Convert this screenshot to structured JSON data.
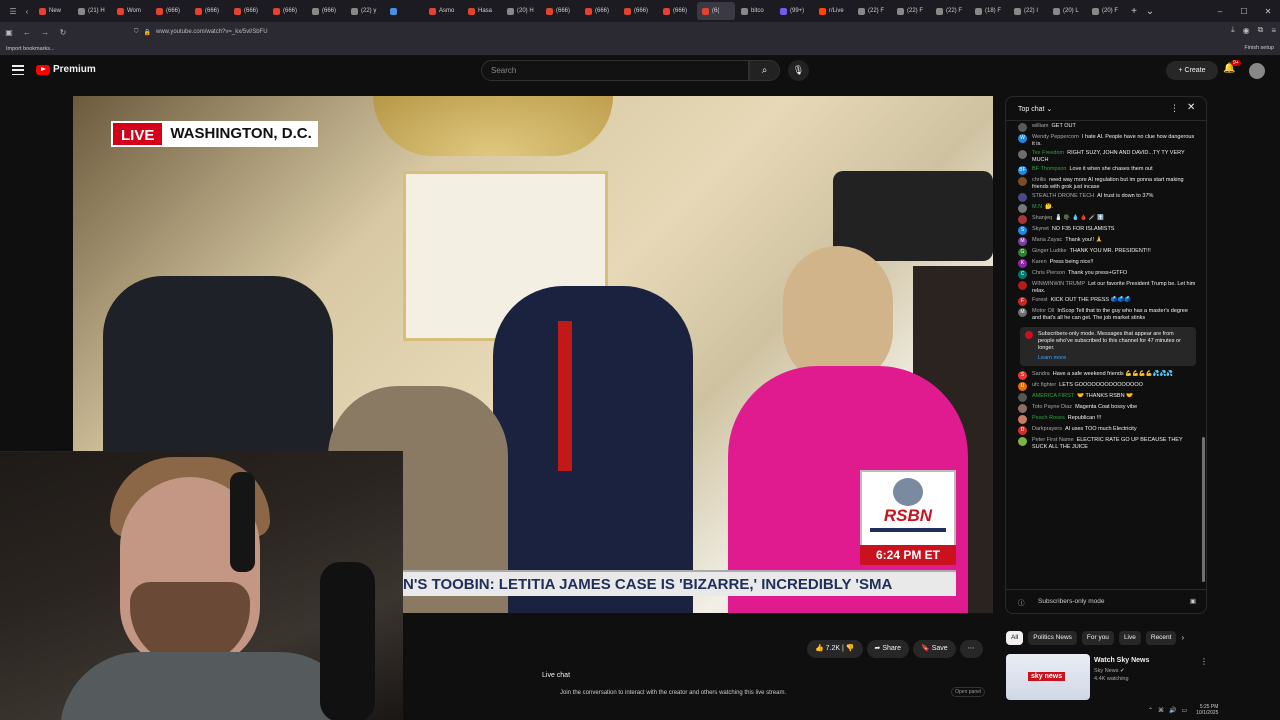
{
  "browser": {
    "tabs": [
      {
        "label": "New",
        "color": "#e3422f"
      },
      {
        "label": "(21) H",
        "color": "#888"
      },
      {
        "label": "Wom",
        "color": "#e3422f"
      },
      {
        "label": "(666)",
        "color": "#e3422f"
      },
      {
        "label": "(666)",
        "color": "#e3422f"
      },
      {
        "label": "(666)",
        "color": "#e3422f"
      },
      {
        "label": "(666)",
        "color": "#e3422f"
      },
      {
        "label": "(666)",
        "color": "#888"
      },
      {
        "label": "(22) y",
        "color": "#888"
      },
      {
        "label": "",
        "color": "#4a90e2"
      },
      {
        "label": "Asmo",
        "color": "#e3422f"
      },
      {
        "label": "Hasa",
        "color": "#e3422f"
      },
      {
        "label": "(20) H",
        "color": "#888"
      },
      {
        "label": "(666)",
        "color": "#e3422f"
      },
      {
        "label": "(666)",
        "color": "#e3422f"
      },
      {
        "label": "(666)",
        "color": "#e3422f"
      },
      {
        "label": "(666)",
        "color": "#e3422f"
      },
      {
        "label": "(6(",
        "color": "#e3422f",
        "active": true
      },
      {
        "label": "bitco",
        "color": "#888"
      },
      {
        "label": "(99+)",
        "color": "#6f5cf0"
      },
      {
        "label": "r/Live",
        "color": "#ff4500"
      },
      {
        "label": "(22) F",
        "color": "#888"
      },
      {
        "label": "(22) F",
        "color": "#888"
      },
      {
        "label": "(22) F",
        "color": "#888"
      },
      {
        "label": "(18) F",
        "color": "#888"
      },
      {
        "label": "(22) I",
        "color": "#888"
      },
      {
        "label": "(20) L",
        "color": "#888"
      },
      {
        "label": "(20) F",
        "color": "#888"
      }
    ],
    "url": "www.youtube.com/watch?v=_kx/5vl/SbFU",
    "bookmarks_item": "Import bookmarks...",
    "finish_setup": "Finish setup"
  },
  "header": {
    "logo_text": "Premium",
    "search_placeholder": "Search",
    "create_label": "Create",
    "notif_badge": "9+"
  },
  "video": {
    "live_label": "LIVE",
    "location": "WASHINGTON, D.C.",
    "ticker": "N'S TOOBIN: LETITIA JAMES CASE IS 'BIZARRE,' INCREDIBLY 'SMA",
    "network": "RSBN",
    "time": "6:24 PM ET"
  },
  "actions": {
    "likes": "7.2K",
    "share": "Share",
    "save": "Save"
  },
  "live_chat_section": {
    "title": "Live chat",
    "subtitle": "Join the conversation to interact with the creator and others watching this live stream.",
    "button": "Open panel"
  },
  "chat": {
    "header": "Top chat",
    "messages": [
      {
        "author": "william",
        "text": "GET OUT",
        "color": "#5a5a5a",
        "initial": ""
      },
      {
        "author": "Wendy Peppercorn",
        "text": "I hate AI. People have no clue how dangerous it is.",
        "color": "#1e88e5",
        "initial": "W"
      },
      {
        "author": "Tex Freedom",
        "text": "RIGHT SUZY, JOHN AND DAVID...TY TY VERY MUCH",
        "color": "#6d6d6d",
        "initial": "",
        "member": true
      },
      {
        "author": "BF Thompson",
        "text": "Love it when she chases them out",
        "color": "#1e88e5",
        "initial": "BF",
        "member": true
      },
      {
        "author": "chrilis",
        "text": "need way more AI regulation but im gonna start making friends with grok just incase",
        "color": "#7a4b2a",
        "initial": ""
      },
      {
        "author": "STEALTH DRONE TECH",
        "text": "AI trust is down to 37%",
        "color": "#4a4a8a",
        "initial": ""
      },
      {
        "author": "M.N",
        "text": "🤔.",
        "color": "#777",
        "initial": "",
        "member": true
      },
      {
        "author": "Shanjeq",
        "text": "🧂 🪖 💧 🩸 🗡️ ⬆️",
        "color": "#a33",
        "initial": ""
      },
      {
        "author": "Skynet",
        "text": "NO F35 FOR ISLAMISTS",
        "color": "#1e88e5",
        "initial": "S"
      },
      {
        "author": "Maria Zayac",
        "text": "Thank you!! 🙏",
        "color": "#7b3fa0",
        "initial": "M"
      },
      {
        "author": "Ginger Ludtke",
        "text": "THANK YOU MR. PRESIDENT!!!",
        "color": "#2e7d32",
        "initial": "G"
      },
      {
        "author": "Karen",
        "text": "Press being nice!!",
        "color": "#8e24aa",
        "initial": "K"
      },
      {
        "author": "Chris Pierson",
        "text": "Thank you press+GTFO",
        "color": "#00796b",
        "initial": "C"
      },
      {
        "author": "WINWINWIN TRUMP",
        "text": "Let our favorite President Trump be. Let him relax.",
        "color": "#b71c1c",
        "initial": ""
      },
      {
        "author": "Forest",
        "text": "KICK OUT THE PRESS 🗳️🗳️🗳️",
        "color": "#c62828",
        "initial": "F"
      },
      {
        "author": "Motor Oil",
        "text": "InScop Tell that to the guy who has a master's degree and that's all he can get. The job market stinks",
        "color": "#6d6d6d",
        "initial": "M"
      }
    ],
    "notice": {
      "text": "Subscribers-only mode. Messages that appear are from people who've subscribed to this channel for 47 minutes or longer.",
      "link": "Learn more"
    },
    "messages_after": [
      {
        "author": "Sandra",
        "text": "Have a safe weekend friends 💪💪💪💪💦💦💦",
        "color": "#e53935",
        "initial": "S"
      },
      {
        "author": "ufc fighter",
        "text": "LETS GOOOOOOOOOOOOOOO",
        "color": "#ef6c00",
        "initial": "U"
      },
      {
        "author": "AMERICA FIRST",
        "text": "🤝 THANKS RSBN 🤝",
        "color": "#555",
        "initial": "",
        "member": true
      },
      {
        "author": "Toto Payne Diaz",
        "text": "Magenta Coat bossy vibe",
        "color": "#8d6e63",
        "initial": ""
      },
      {
        "author": "Peach Roses",
        "text": "Republican !!!",
        "color": "#c97b63",
        "initial": "",
        "member": true
      },
      {
        "author": "Darkprayers",
        "text": "AI uses TOO much Electricity",
        "color": "#d32f2f",
        "initial": "D"
      },
      {
        "author": "Peter First Name",
        "text": "ELECTRIC RATE GO UP BECAUSE THEY SUCK ALL THE JUICE",
        "color": "#7cb342",
        "initial": ""
      }
    ],
    "footer": "Subscribers-only mode"
  },
  "chips": [
    "All",
    "Politics News",
    "For you",
    "Live",
    "Recent"
  ],
  "recommendation": {
    "title": "Watch Sky News",
    "channel": "Sky News",
    "views": "4.4K watching",
    "thumb_text": "sky news"
  },
  "taskbar": {
    "time": "5:25 PM",
    "date": "10/1/2025"
  }
}
